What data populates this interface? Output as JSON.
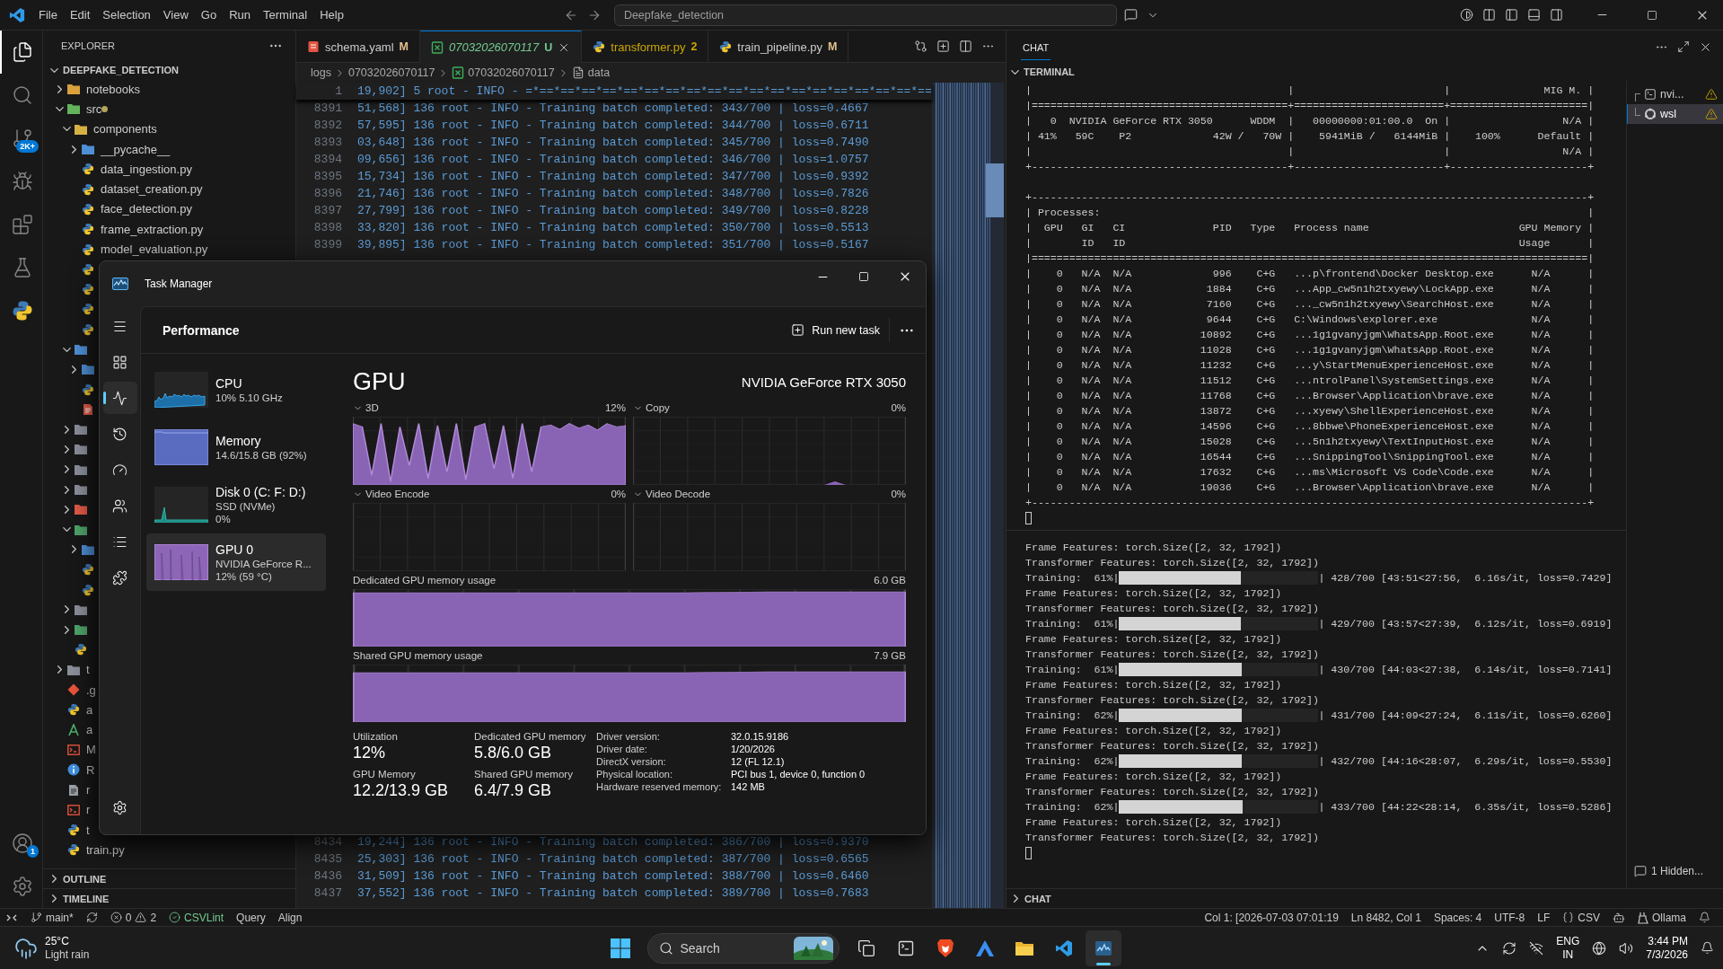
{
  "title_bar": {
    "menu": [
      "File",
      "Edit",
      "Selection",
      "View",
      "Go",
      "Run",
      "Terminal",
      "Help"
    ],
    "search": "Deepfake_detection"
  },
  "activity_bar": {
    "items": [
      {
        "kind": "explorer",
        "selected": true
      },
      {
        "kind": "search",
        "selected": false
      },
      {
        "kind": "source-control",
        "selected": false,
        "badge": "2K+"
      },
      {
        "kind": "run",
        "selected": false
      },
      {
        "kind": "extensions",
        "selected": false
      },
      {
        "kind": "testing",
        "selected": false
      },
      {
        "kind": "python",
        "selected": false
      }
    ],
    "bottom": [
      {
        "kind": "account",
        "badge": "1"
      },
      {
        "kind": "settings"
      }
    ]
  },
  "explorer": {
    "title": "EXPLORER",
    "folder": {
      "name": "DEEPFAKE_DETECTION",
      "expanded": true
    },
    "tree": [
      {
        "name": "notebooks",
        "kind": "folder-special",
        "expanded": false
      },
      {
        "name": "src",
        "kind": "folder-src",
        "expanded": true,
        "modified": true,
        "children": [
          {
            "name": "components",
            "kind": "folder-components",
            "expanded": true,
            "children": [
              {
                "name": "__pycache__",
                "kind": "folder-blue",
                "expanded": false
              },
              {
                "name": "data_ingestion.py",
                "kind": "python"
              },
              {
                "name": "dataset_creation.py",
                "kind": "python"
              },
              {
                "name": "face_detection.py",
                "kind": "python"
              },
              {
                "name": "frame_extraction.py",
                "kind": "python"
              },
              {
                "name": "model_evaluation.py",
                "kind": "python"
              },
              {
                "kind": "python"
              },
              {
                "kind": "python"
              },
              {
                "kind": "python"
              },
              {
                "kind": "python"
              }
            ]
          },
          {
            "kind": "folder-blue",
            "expanded": true,
            "children": [
              {
                "kind": "folder-blue",
                "expanded": false
              },
              {
                "kind": "python"
              },
              {
                "kind": "doc-red"
              }
            ]
          },
          {
            "kind": "folder-gray",
            "expanded": false
          },
          {
            "kind": "folder-gray",
            "expanded": false
          },
          {
            "kind": "folder-gray",
            "expanded": false
          },
          {
            "kind": "folder-gray",
            "expanded": false
          },
          {
            "kind": "folder-red",
            "expanded": false
          },
          {
            "kind": "folder-green",
            "expanded": true,
            "children": [
              {
                "kind": "folder-blue",
                "expanded": false
              },
              {
                "kind": "python"
              },
              {
                "kind": "python"
              }
            ]
          },
          {
            "kind": "folder-gray",
            "expanded": false
          },
          {
            "kind": "folder-green",
            "expanded": false
          },
          {
            "kind": "python"
          }
        ]
      },
      {
        "name": "t",
        "kind": "folder-gray",
        "expanded": false
      },
      {
        "name": ".g",
        "kind": "git"
      },
      {
        "name": "a",
        "kind": "python"
      },
      {
        "name": "a",
        "kind": "grammar"
      },
      {
        "name": "M",
        "kind": "terminal"
      },
      {
        "name": "R",
        "kind": "info"
      },
      {
        "name": "r",
        "kind": "doc"
      },
      {
        "name": "r",
        "kind": "terminal"
      },
      {
        "name": "t",
        "kind": "python"
      },
      {
        "name": "train.py",
        "kind": "python"
      }
    ],
    "sections": [
      {
        "name": "OUTLINE",
        "expanded": false
      },
      {
        "name": "TIMELINE",
        "expanded": false
      }
    ]
  },
  "editor": {
    "tabs": [
      {
        "label": "schema.yaml",
        "kind": "yaml",
        "tinted": false,
        "color": "#e2c08d",
        "badge": "M",
        "selected": false,
        "preview": false
      },
      {
        "label": "07032026070117",
        "kind": "log",
        "tinted": true,
        "color": "#73c991",
        "badge": "U",
        "selected": true,
        "preview": true
      },
      {
        "label": "transformer.py",
        "kind": "python",
        "tinted": true,
        "color": "#cca700",
        "badge": "2",
        "selected": false,
        "preview": false
      },
      {
        "label": "train_pipeline.py",
        "kind": "python",
        "tinted": false,
        "color": "#e2c08d",
        "badge": "M",
        "selected": false,
        "preview": false
      }
    ],
    "breadcrumb": [
      {
        "label": "logs",
        "kind": "folder"
      },
      {
        "label": "07032026070117",
        "kind": "folder"
      },
      {
        "label": "07032026070117",
        "kind": "log"
      },
      {
        "label": "data",
        "kind": "symbol"
      }
    ],
    "sticky_line": {
      "number": "1",
      "text": "19,902] 5 root - INFO - =*==*==*==*==*==*==*==*==*==*==*==*==*==*==*==*==*==*==*=="
    },
    "lines_top": [
      {
        "number": "8391",
        "text": "51,568] 136 root - INFO - Training batch completed: 343/700 | loss=0.4667"
      },
      {
        "number": "8392",
        "text": "57,595] 136 root - INFO - Training batch completed: 344/700 | loss=0.6711"
      },
      {
        "number": "8393",
        "text": "03,648] 136 root - INFO - Training batch completed: 345/700 | loss=0.7490"
      },
      {
        "number": "8394",
        "text": "09,656] 136 root - INFO - Training batch completed: 346/700 | loss=1.0757"
      },
      {
        "number": "8395",
        "text": "15,734] 136 root - INFO - Training batch completed: 347/700 | loss=0.9392"
      },
      {
        "number": "8396",
        "text": "21,746] 136 root - INFO - Training batch completed: 348/700 | loss=0.7826"
      },
      {
        "number": "8397",
        "text": "27,799] 136 root - INFO - Training batch completed: 349/700 | loss=0.8228"
      },
      {
        "number": "8398",
        "text": "33,820] 136 root - INFO - Training batch completed: 350/700 | loss=0.5513"
      },
      {
        "number": "8399",
        "text": "39,895] 136 root - INFO - Training batch completed: 351/700 | loss=0.5167"
      }
    ],
    "lines_bottom": [
      {
        "number": "8434",
        "text": "19,244] 136 root - INFO - Training batch completed: 386/700 | loss=0.9370"
      },
      {
        "number": "8435",
        "text": "25,303] 136 root - INFO - Training batch completed: 387/700 | loss=0.6565"
      },
      {
        "number": "8436",
        "text": "31,509] 136 root - INFO - Training batch completed: 388/700 | loss=0.6460"
      },
      {
        "number": "8437",
        "text": "37,552] 136 root - INFO - Training batch completed: 389/700 | loss=0.7683"
      }
    ]
  },
  "panel": {
    "tab": "CHAT",
    "terminal": {
      "title": "TERMINAL",
      "gpu_lines": [
        "|                                         |                        |               MIG M. |",
        "|=========================================+========================+======================|",
        "|   0  NVIDIA GeForce RTX 3050      WDDM  |   00000000:01:00.0  On |                  N/A |",
        "| 41%   59C    P2             42W /   70W |    5941MiB /   6144MiB |    100%      Default |",
        "|                                         |                        |                  N/A |",
        "+-----------------------------------------+------------------------+----------------------+"
      ],
      "process_lines": [
        "+-----------------------------------------------------------------------------------------+",
        "| Processes:                                                                              |",
        "|  GPU   GI   CI              PID   Type   Process name                        GPU Memory |",
        "|        ID   ID                                                               Usage      |",
        "|=========================================================================================|",
        "|    0   N/A  N/A             996    C+G   ...p\\frontend\\Docker Desktop.exe      N/A      |",
        "|    0   N/A  N/A            1884    C+G   ...App_cw5n1h2txyewy\\LockApp.exe      N/A      |",
        "|    0   N/A  N/A            7160    C+G   ..._cw5n1h2txyewy\\SearchHost.exe      N/A      |",
        "|    0   N/A  N/A            9644    C+G   C:\\Windows\\explorer.exe               N/A      |",
        "|    0   N/A  N/A           10892    C+G   ...1g1gvanyjgm\\WhatsApp.Root.exe      N/A      |",
        "|    0   N/A  N/A           11028    C+G   ...1g1gvanyjgm\\WhatsApp.Root.exe      N/A      |",
        "|    0   N/A  N/A           11232    C+G   ...y\\StartMenuExperienceHost.exe      N/A      |",
        "|    0   N/A  N/A           11512    C+G   ...ntrolPanel\\SystemSettings.exe      N/A      |",
        "|    0   N/A  N/A           11768    C+G   ...Browser\\Application\\brave.exe      N/A      |",
        "|    0   N/A  N/A           13872    C+G   ...xyewy\\ShellExperienceHost.exe      N/A      |",
        "|    0   N/A  N/A           14596    C+G   ...8bbwe\\PhoneExperienceHost.exe      N/A      |",
        "|    0   N/A  N/A           15028    C+G   ...5n1h2txyewy\\TextInputHost.exe      N/A      |",
        "|    0   N/A  N/A           16544    C+G   ...SnippingTool\\SnippingTool.exe      N/A      |",
        "|    0   N/A  N/A           17632    C+G   ...ms\\Microsoft VS Code\\Code.exe      N/A      |",
        "|    0   N/A  N/A           19036    C+G   ...Browser\\Application\\brave.exe      N/A      |",
        "+-----------------------------------------------------------------------------------------+"
      ],
      "sessions": [
        {
          "name": "nvi...",
          "kind": "shell",
          "selected": false,
          "warning": true
        },
        {
          "name": "wsl",
          "kind": "linux",
          "selected": true,
          "warning": true
        }
      ],
      "output": [
        {
          "kind": "text",
          "text": "Frame Features: torch.Size([2, 32, 1792])"
        },
        {
          "kind": "text",
          "text": "Transformer Features: torch.Size([2, 32, 1792])"
        },
        {
          "kind": "progress",
          "prefix": "Training:  61%|",
          "level": 0.611,
          "suffix": "| 428/700 [43:51<27:56,  6.16s/it, loss=0.7429]"
        },
        {
          "kind": "text",
          "text": "Frame Features: torch.Size([2, 32, 1792])"
        },
        {
          "kind": "text",
          "text": "Transformer Features: torch.Size([2, 32, 1792])"
        },
        {
          "kind": "progress",
          "prefix": "Training:  61%|",
          "level": 0.613,
          "suffix": "| 429/700 [43:57<27:39,  6.12s/it, loss=0.6919]"
        },
        {
          "kind": "text",
          "text": "Frame Features: torch.Size([2, 32, 1792])"
        },
        {
          "kind": "text",
          "text": "Transformer Features: torch.Size([2, 32, 1792])"
        },
        {
          "kind": "progress",
          "prefix": "Training:  61%|",
          "level": 0.614,
          "suffix": "| 430/700 [44:03<27:38,  6.14s/it, loss=0.7141]"
        },
        {
          "kind": "text",
          "text": "Frame Features: torch.Size([2, 32, 1792])"
        },
        {
          "kind": "text",
          "text": "Transformer Features: torch.Size([2, 32, 1792])"
        },
        {
          "kind": "progress",
          "prefix": "Training:  62%|",
          "level": 0.616,
          "suffix": "| 431/700 [44:09<27:24,  6.11s/it, loss=0.6260]"
        },
        {
          "kind": "text",
          "text": "Frame Features: torch.Size([2, 32, 1792])"
        },
        {
          "kind": "text",
          "text": "Transformer Features: torch.Size([2, 32, 1792])"
        },
        {
          "kind": "progress",
          "prefix": "Training:  62%|",
          "level": 0.617,
          "suffix": "| 432/700 [44:16<28:07,  6.29s/it, loss=0.5530]"
        },
        {
          "kind": "text",
          "text": "Frame Features: torch.Size([2, 32, 1792])"
        },
        {
          "kind": "text",
          "text": "Transformer Features: torch.Size([2, 32, 1792])"
        },
        {
          "kind": "progress",
          "prefix": "Training:  62%|",
          "level": 0.619,
          "suffix": "| 433/700 [44:22<28:14,  6.35s/it, loss=0.5286]"
        },
        {
          "kind": "text",
          "text": "Frame Features: torch.Size([2, 32, 1792])"
        },
        {
          "kind": "text",
          "text": "Transformer Features: torch.Size([2, 32, 1792])"
        }
      ],
      "hidden_notice": "1 Hidden..."
    },
    "chat": {
      "title": "CHAT",
      "expanded": false
    }
  },
  "task_manager": {
    "title": "Task Manager",
    "nav": [
      {
        "kind": "menu",
        "selected": false
      },
      {
        "kind": "processes",
        "selected": false
      },
      {
        "kind": "performance",
        "selected": true
      },
      {
        "kind": "history",
        "selected": false
      },
      {
        "kind": "startup",
        "selected": false
      },
      {
        "kind": "users",
        "selected": false
      },
      {
        "kind": "details",
        "selected": false
      },
      {
        "kind": "services",
        "selected": false
      },
      {
        "kind": "settings",
        "selected": false
      }
    ],
    "page_title": "Performance",
    "run_task": "Run new task",
    "resources": [
      {
        "kind": "cpu",
        "name": "CPU",
        "detail": "10%  5.10 GHz",
        "selected": false
      },
      {
        "kind": "memory",
        "name": "Memory",
        "detail": "14.6/15.8 GB (92%)",
        "selected": false
      },
      {
        "kind": "disk",
        "name": "Disk 0 (C: F: D:)",
        "detail": "SSD (NVMe)",
        "detail2": "0%",
        "selected": false
      },
      {
        "kind": "gpu",
        "name": "GPU 0",
        "detail": "NVIDIA GeForce R...",
        "detail2": "12%  (59 °C)",
        "selected": true
      }
    ],
    "gpu": {
      "title": "GPU",
      "model": "NVIDIA GeForce RTX 3050",
      "engines": [
        {
          "name": "3D",
          "value": "12%",
          "kind": "busy"
        },
        {
          "name": "Copy",
          "value": "0%",
          "kind": "blip"
        },
        {
          "name": "Video Encode",
          "value": "0%",
          "kind": "idle"
        },
        {
          "name": "Video Decode",
          "value": "0%",
          "kind": "idle"
        }
      ],
      "memory_graphs": [
        {
          "label": "Dedicated GPU memory usage",
          "max": "6.0 GB",
          "kind": "full"
        },
        {
          "label": "Shared GPU memory usage",
          "max": "7.9 GB",
          "kind": "high"
        }
      ],
      "stats": [
        {
          "label": "Utilization",
          "value": "12%"
        },
        {
          "label": "Dedicated GPU memory",
          "value": "5.8/6.0 GB"
        },
        {
          "label": "GPU Memory",
          "value": "12.2/13.9 GB"
        },
        {
          "label": "Shared GPU memory",
          "value": "6.4/7.9 GB"
        }
      ],
      "properties": [
        {
          "label": "Driver version:",
          "value": "32.0.15.9186"
        },
        {
          "label": "Driver date:",
          "value": "1/20/2026"
        },
        {
          "label": "DirectX version:",
          "value": "12 (FL 12.1)"
        },
        {
          "label": "Physical location:",
          "value": "PCI bus 1, device 0, function 0"
        },
        {
          "label": "Hardware reserved memory:",
          "value": "142 MB"
        }
      ]
    }
  },
  "status_bar": {
    "left": [
      {
        "kind": "remote"
      },
      {
        "kind": "branch",
        "text": "main*"
      },
      {
        "kind": "sync"
      },
      {
        "kind": "problems",
        "errors": "0",
        "warnings": "2"
      },
      {
        "kind": "lint",
        "text": "CSVLint"
      },
      {
        "kind": "text",
        "text": "Query"
      },
      {
        "kind": "text",
        "text": "Align"
      }
    ],
    "right": [
      {
        "kind": "text",
        "text": "Col 1: [2026-07-03 07:01:19"
      },
      {
        "kind": "text",
        "text": "Ln 8482, Col 1"
      },
      {
        "kind": "text",
        "text": "Spaces: 4"
      },
      {
        "kind": "text",
        "text": "UTF-8"
      },
      {
        "kind": "text",
        "text": "LF"
      },
      {
        "kind": "language",
        "text": "CSV"
      },
      {
        "kind": "copilot"
      },
      {
        "kind": "ollama",
        "text": "Ollama"
      },
      {
        "kind": "bell"
      }
    ]
  },
  "taskbar": {
    "weather": {
      "temp": "25°C",
      "desc": "Light rain"
    },
    "search": "Search",
    "apps": [
      {
        "kind": "task-view",
        "selected": false
      },
      {
        "kind": "terminal",
        "selected": false
      },
      {
        "kind": "brave",
        "selected": false
      },
      {
        "kind": "a-app",
        "selected": false
      },
      {
        "kind": "files",
        "selected": false
      },
      {
        "kind": "vscode",
        "selected": false
      },
      {
        "kind": "task-manager",
        "selected": true
      }
    ],
    "tray": {
      "lang": "ENG",
      "region": "IN",
      "time": "3:44 PM",
      "date": "7/3/2026"
    }
  }
}
